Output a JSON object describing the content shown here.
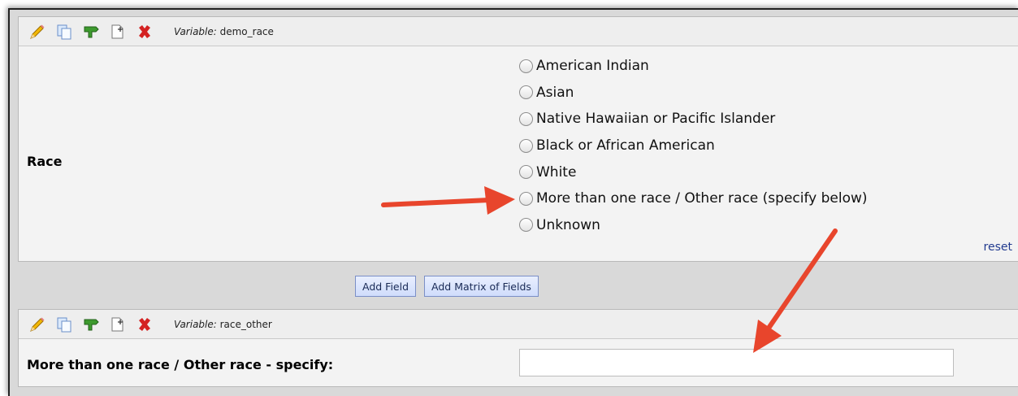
{
  "field1": {
    "variable_prefix": "Variable:",
    "variable_name": " demo_race",
    "label": "Race",
    "options": [
      "American Indian",
      "Asian",
      "Native Hawaiian or Pacific Islander",
      "Black or African American",
      "White",
      "More than one race / Other race (specify below)",
      "Unknown"
    ],
    "reset_label": "reset"
  },
  "add_buttons": {
    "add_field": "Add Field",
    "add_matrix": "Add Matrix of Fields"
  },
  "field2": {
    "variable_prefix": "Variable:",
    "variable_name": " race_other",
    "label": "More than one race / Other race - specify:",
    "input_value": ""
  },
  "toolbar_icons": [
    "edit-pencil-icon",
    "copy-icon",
    "branching-icon",
    "move-icon",
    "delete-icon"
  ],
  "colors": {
    "arrow": "#e8452c",
    "delete": "#d42222",
    "branch": "#3d9a2e",
    "button_bg": "#d6e1fb",
    "link": "#223b8f"
  }
}
